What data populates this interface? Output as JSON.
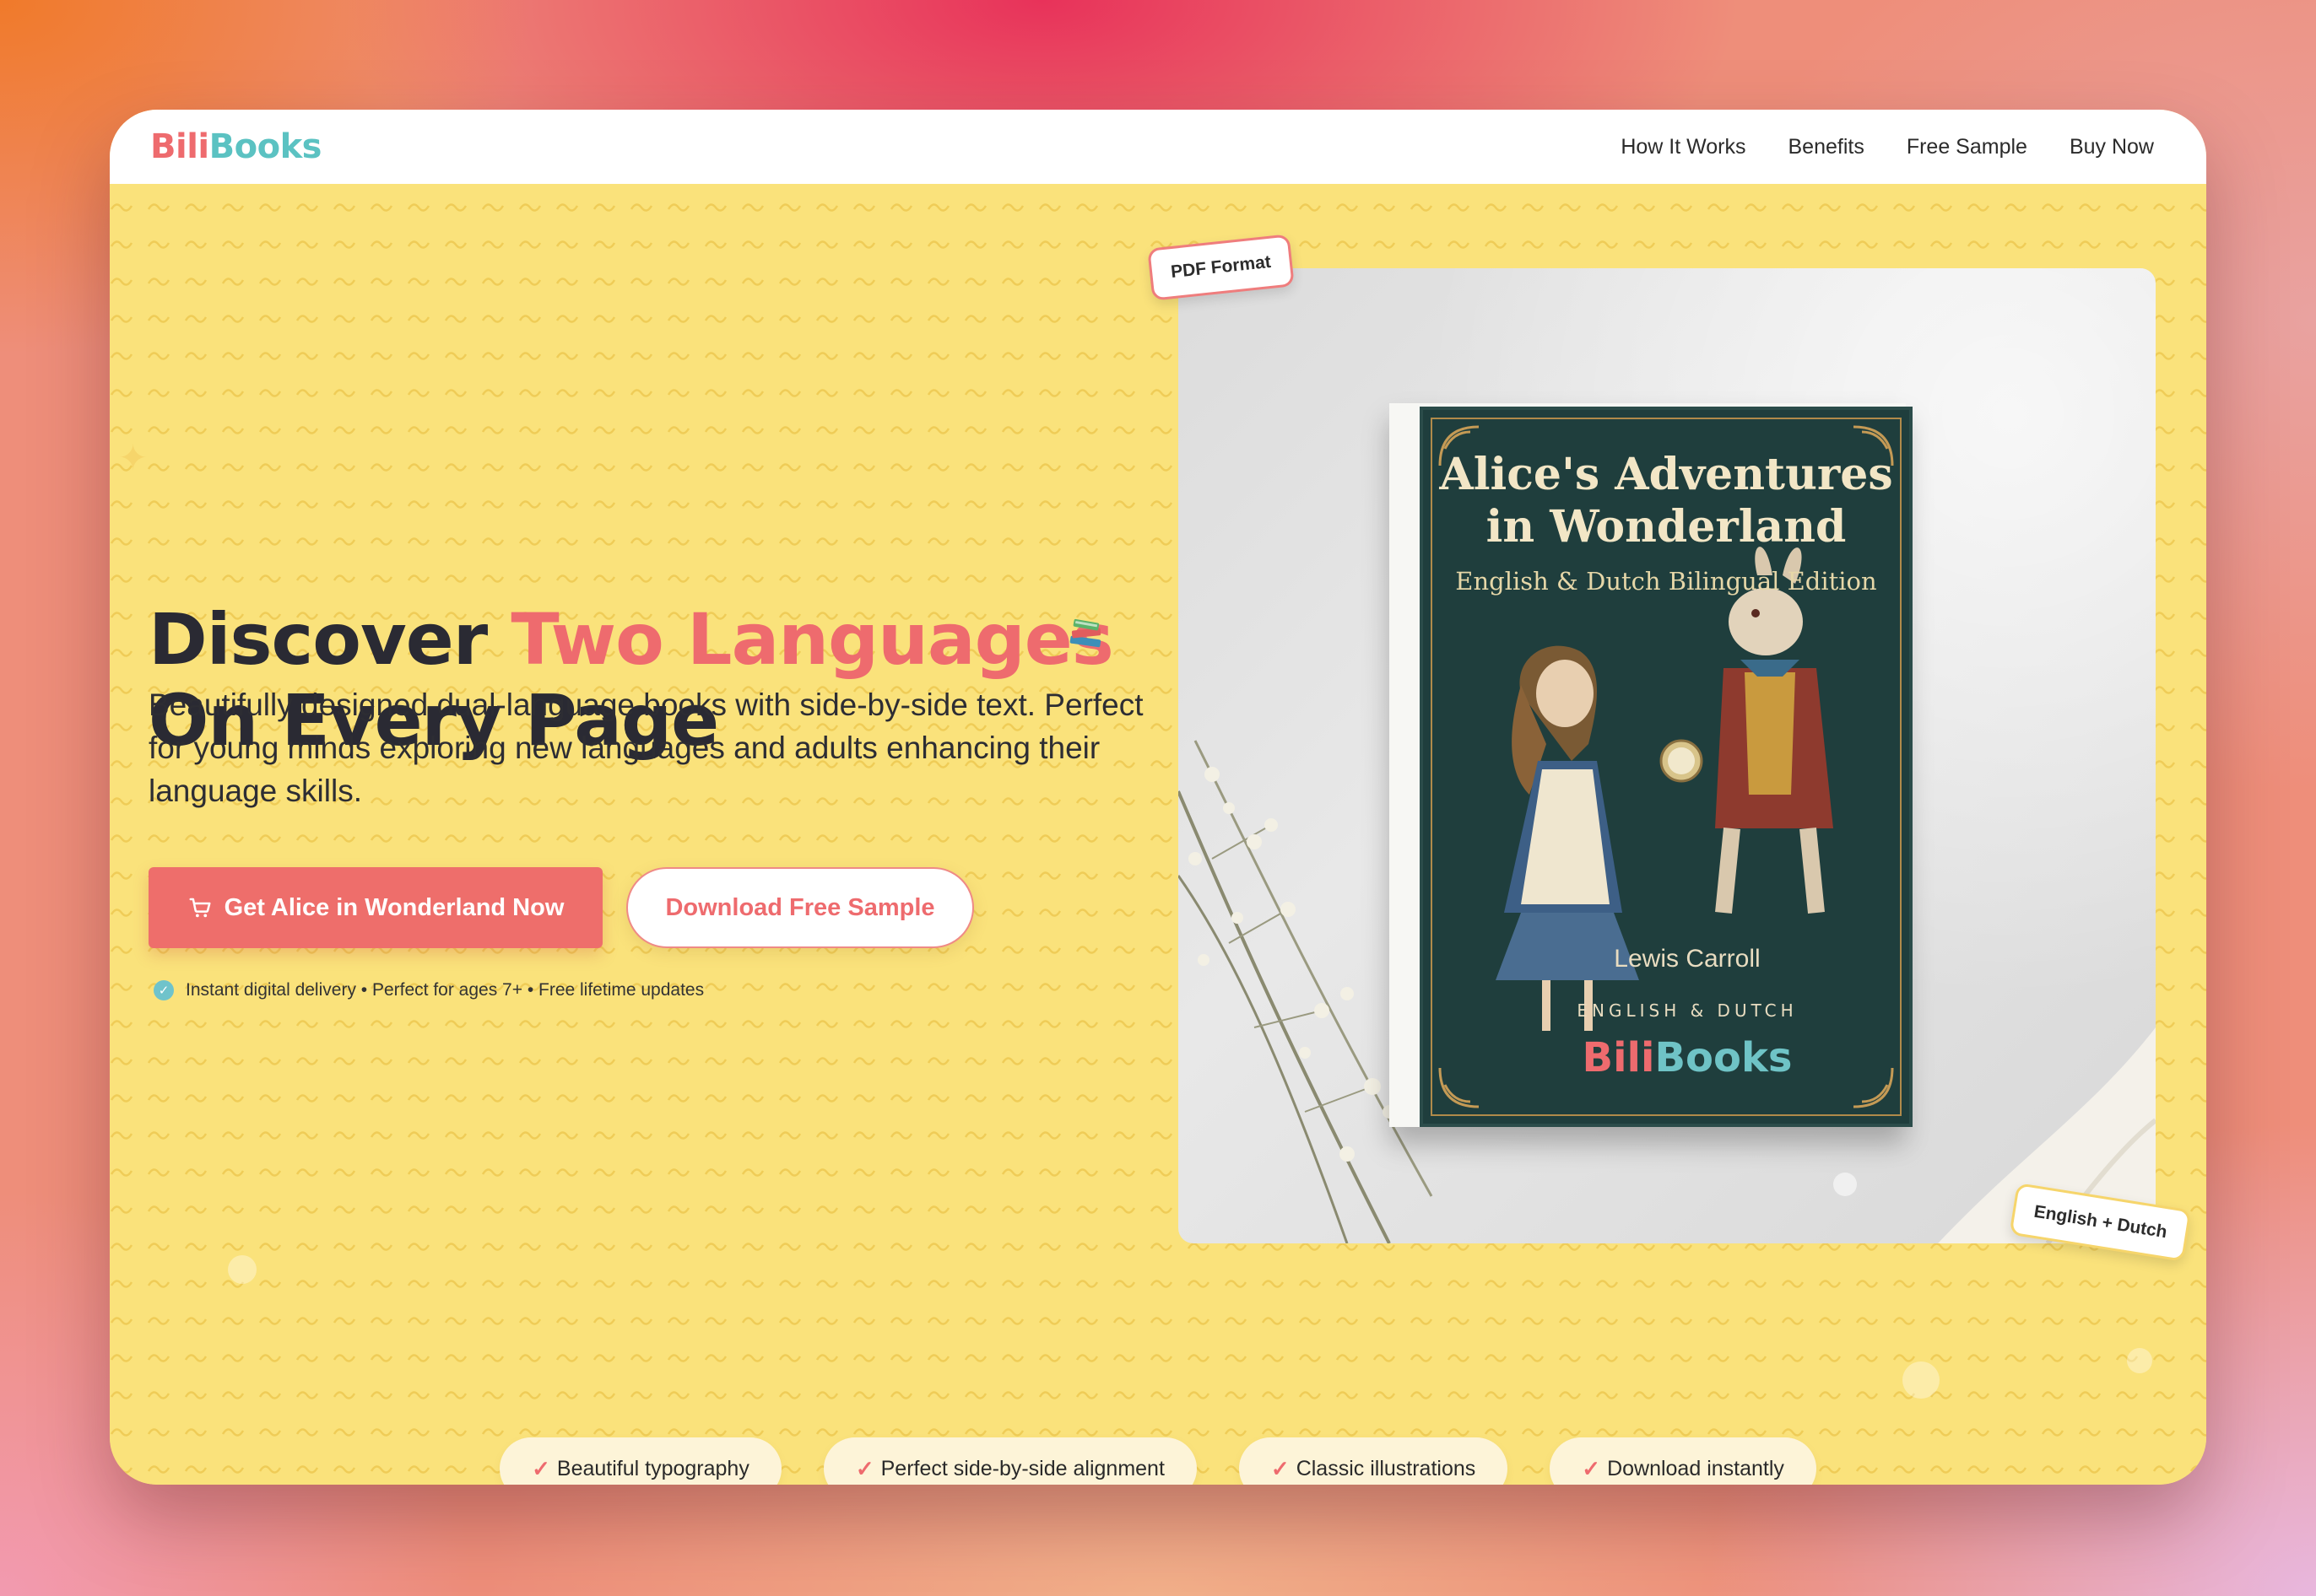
{
  "brand": {
    "part1": "Bili",
    "part2": "Books",
    "color1": "#ee6b6e",
    "color2": "#5bc2c2"
  },
  "nav": {
    "items": [
      "How It Works",
      "Benefits",
      "Free Sample",
      "Buy Now"
    ]
  },
  "hero": {
    "title_part1": "Discover ",
    "title_accent": "Two Languages",
    "title_part2": "On Every Page",
    "subtitle": "Beautifully designed dual-language books with side-by-side text. Perfect for young minds exploring new languages and adults enhancing their language skills.",
    "primary_cta": "Get Alice in Wonderland Now",
    "secondary_cta": "Download Free Sample",
    "delivery_note": "Instant digital delivery • Perfect for ages 7+ • Free lifetime updates"
  },
  "tags": {
    "pdf": "PDF Format",
    "languages": "English + Dutch"
  },
  "book": {
    "title": "Alice's Adventures in Wonderland",
    "subtitle": "English & Dutch Bilingual Edition",
    "author": "Lewis Carroll",
    "languages": "ENGLISH & DUTCH",
    "logo_part1": "Bili",
    "logo_part2": "Books"
  },
  "features": [
    "Beautiful typography",
    "Perfect side-by-side alignment",
    "Classic illustrations",
    "Download instantly"
  ],
  "colors": {
    "accent": "#ee6b6e",
    "hero_bg": "#fae27b",
    "teal": "#5bc2c2",
    "cover": "#1f3e3d"
  }
}
